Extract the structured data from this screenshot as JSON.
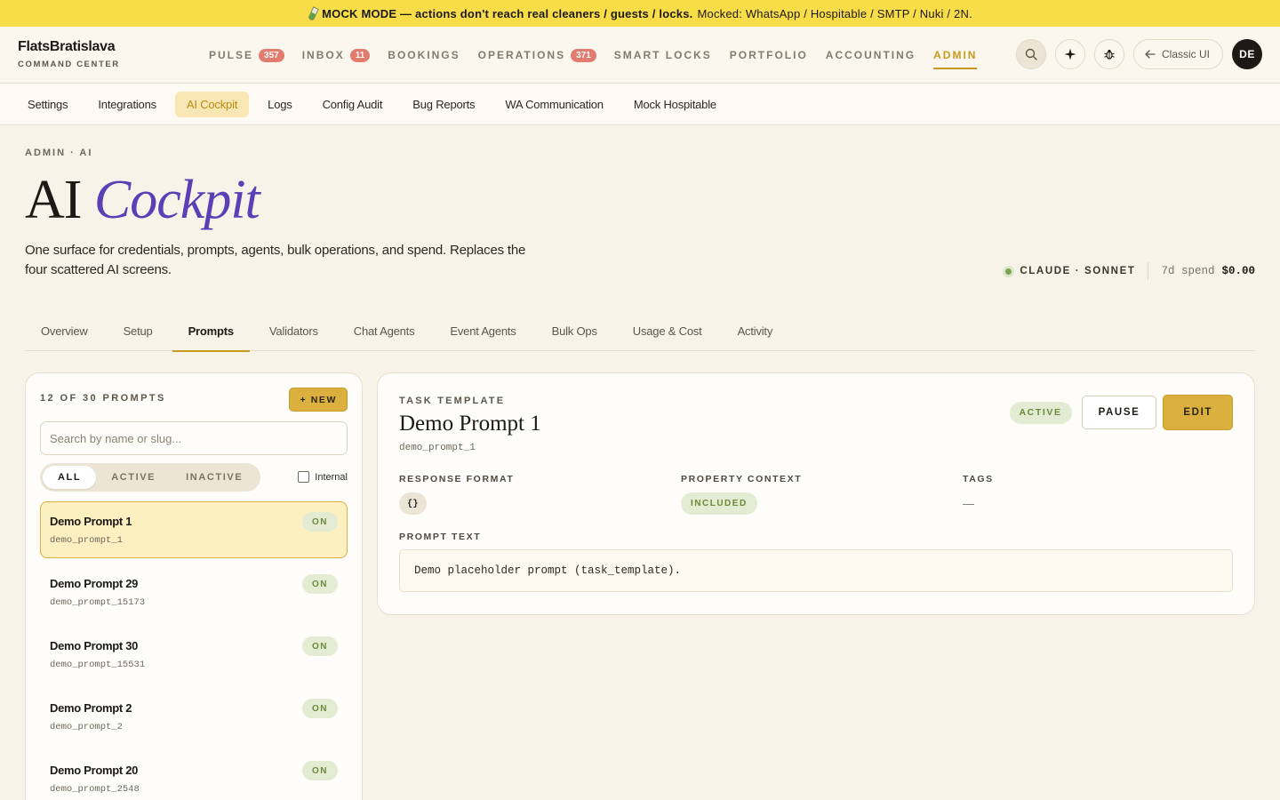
{
  "banner": {
    "title": "MOCK MODE — actions don't reach real cleaners / guests / locks.",
    "detail": "Mocked: WhatsApp / Hospitable / SMTP / Nuki / 2N."
  },
  "brand": {
    "name": "FlatsBratislava",
    "subtitle": "COMMAND CENTER"
  },
  "nav": {
    "items": [
      {
        "label": "PULSE",
        "badge": "357"
      },
      {
        "label": "INBOX",
        "badge": "11"
      },
      {
        "label": "BOOKINGS"
      },
      {
        "label": "OPERATIONS",
        "badge": "371"
      },
      {
        "label": "SMART LOCKS"
      },
      {
        "label": "PORTFOLIO"
      },
      {
        "label": "ACCOUNTING"
      },
      {
        "label": "ADMIN",
        "active": true
      }
    ],
    "classic_label": "Classic UI",
    "avatar": "DE"
  },
  "subnav": {
    "items": [
      "Settings",
      "Integrations",
      "AI Cockpit",
      "Logs",
      "Config Audit",
      "Bug Reports",
      "WA Communication",
      "Mock Hospitable"
    ],
    "active": "AI Cockpit"
  },
  "page": {
    "eyebrow": "ADMIN · AI",
    "title_plain": "AI ",
    "title_accent": "Cockpit",
    "description": "One surface for credentials, prompts, agents, bulk operations, and spend. Replaces the four scattered AI screens.",
    "model": "CLAUDE · SONNET",
    "spend_label": "7d spend",
    "spend_value": "$0.00"
  },
  "tabs": {
    "items": [
      "Overview",
      "Setup",
      "Prompts",
      "Validators",
      "Chat Agents",
      "Event Agents",
      "Bulk Ops",
      "Usage & Cost",
      "Activity"
    ],
    "active": "Prompts"
  },
  "list": {
    "count": "12 OF 30 PROMPTS",
    "new_label": "+ NEW",
    "search_placeholder": "Search by name or slug...",
    "filters": [
      "ALL",
      "ACTIVE",
      "INACTIVE"
    ],
    "active_filter": "ALL",
    "internal_label": "Internal",
    "internal_checked": false,
    "prompts": [
      {
        "name": "Demo Prompt 1",
        "slug": "demo_prompt_1",
        "status": "ON",
        "selected": true
      },
      {
        "name": "Demo Prompt 29",
        "slug": "demo_prompt_15173",
        "status": "ON"
      },
      {
        "name": "Demo Prompt 30",
        "slug": "demo_prompt_15531",
        "status": "ON"
      },
      {
        "name": "Demo Prompt 2",
        "slug": "demo_prompt_2",
        "status": "ON"
      },
      {
        "name": "Demo Prompt 20",
        "slug": "demo_prompt_2548",
        "status": "ON"
      }
    ]
  },
  "detail": {
    "eyebrow": "TASK TEMPLATE",
    "title": "Demo Prompt 1",
    "slug": "demo_prompt_1",
    "status": "ACTIVE",
    "pause_label": "PAUSE",
    "edit_label": "EDIT",
    "response_format_label": "RESPONSE FORMAT",
    "response_format_value": "{}",
    "property_context_label": "PROPERTY CONTEXT",
    "property_context_value": "INCLUDED",
    "tags_label": "TAGS",
    "tags_value": "—",
    "prompt_text_label": "PROMPT TEXT",
    "prompt_text": "Demo placeholder prompt (task_template)."
  },
  "colors": {
    "banner": "#f8dd49",
    "accent_gold": "#dcb03f",
    "nav_active": "#c79a1e",
    "title_accent": "#5b3fb5",
    "badge_red": "#e17c6e",
    "status_green": "#6b8a3a"
  }
}
